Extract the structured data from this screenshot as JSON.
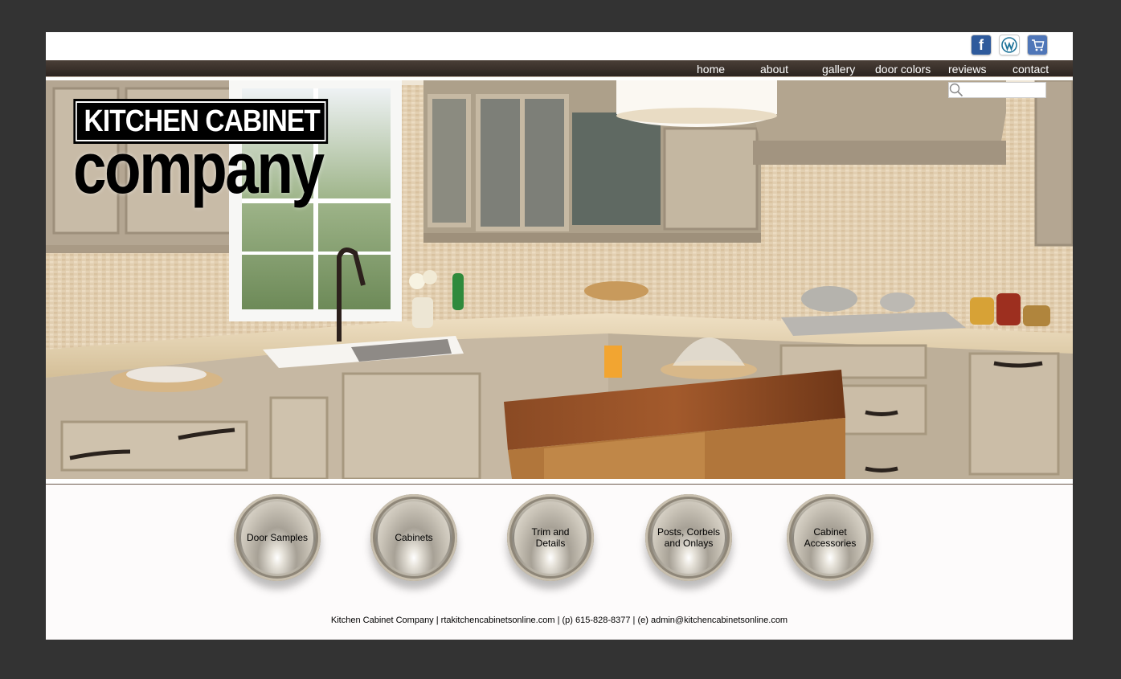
{
  "social": {
    "facebook": {
      "icon": "facebook-icon",
      "glyph": "f"
    },
    "wordpress": {
      "icon": "wordpress-icon"
    },
    "cart": {
      "icon": "shopping-cart-icon"
    }
  },
  "nav": {
    "items": [
      "home",
      "about",
      "gallery",
      "door colors",
      "reviews",
      "contact"
    ]
  },
  "search": {
    "value": "",
    "placeholder": "",
    "icon": "search-icon"
  },
  "logo": {
    "line1": "KITCHEN CABINET",
    "line2": "company"
  },
  "categories": [
    {
      "label": "Door Samples"
    },
    {
      "label": "Cabinets"
    },
    {
      "label": "Trim and Details"
    },
    {
      "label": "Posts, Corbels and Onlays"
    },
    {
      "label": "Cabinet Accessories"
    }
  ],
  "footer": {
    "text": "Kitchen Cabinet Company | rtakitchencabinetsonline.com |  (p) 615-828-8377 | (e) admin@kitchencabinetsonline.com"
  },
  "colors": {
    "background": "#333333",
    "navbar": "#3a302a",
    "facebook": "#2e5a9c",
    "cart": "#4f76b8"
  }
}
